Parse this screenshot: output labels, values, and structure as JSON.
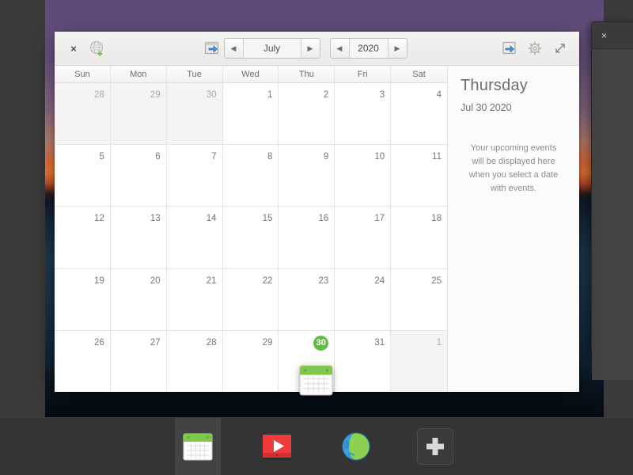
{
  "desktop": {
    "wallpaper_name": "sunset-lake-wallpaper",
    "background_window": {
      "close_label": "×"
    }
  },
  "calendar_window": {
    "toolbar": {
      "close_label": "×",
      "add_web_calendar_icon": "globe-plus-icon",
      "export_icon": "export-arrow-icon",
      "settings_icon": "gear-icon",
      "fullscreen_icon": "fullscreen-icon",
      "prev_month_label": "◀",
      "next_month_label": "▶",
      "month_value": "July",
      "prev_year_label": "◀",
      "next_year_label": "▶",
      "year_value": "2020"
    },
    "grid": {
      "day_headers": [
        "Sun",
        "Mon",
        "Tue",
        "Wed",
        "Thu",
        "Fri",
        "Sat"
      ],
      "weeks": [
        [
          {
            "num": "28",
            "out": true
          },
          {
            "num": "29",
            "out": true
          },
          {
            "num": "30",
            "out": true
          },
          {
            "num": "1",
            "out": false
          },
          {
            "num": "2",
            "out": false
          },
          {
            "num": "3",
            "out": false
          },
          {
            "num": "4",
            "out": false
          }
        ],
        [
          {
            "num": "5",
            "out": false
          },
          {
            "num": "6",
            "out": false
          },
          {
            "num": "7",
            "out": false
          },
          {
            "num": "8",
            "out": false
          },
          {
            "num": "9",
            "out": false
          },
          {
            "num": "10",
            "out": false
          },
          {
            "num": "11",
            "out": false
          }
        ],
        [
          {
            "num": "12",
            "out": false
          },
          {
            "num": "13",
            "out": false
          },
          {
            "num": "14",
            "out": false
          },
          {
            "num": "15",
            "out": false
          },
          {
            "num": "16",
            "out": false
          },
          {
            "num": "17",
            "out": false
          },
          {
            "num": "18",
            "out": false
          }
        ],
        [
          {
            "num": "19",
            "out": false
          },
          {
            "num": "20",
            "out": false
          },
          {
            "num": "21",
            "out": false
          },
          {
            "num": "22",
            "out": false
          },
          {
            "num": "23",
            "out": false
          },
          {
            "num": "24",
            "out": false
          },
          {
            "num": "25",
            "out": false
          }
        ],
        [
          {
            "num": "26",
            "out": false
          },
          {
            "num": "27",
            "out": false
          },
          {
            "num": "28",
            "out": false
          },
          {
            "num": "29",
            "out": false
          },
          {
            "num": "30",
            "out": false,
            "today": true
          },
          {
            "num": "31",
            "out": false
          },
          {
            "num": "1",
            "out": true
          }
        ]
      ]
    },
    "sidebar": {
      "weekday": "Thursday",
      "date": "Jul 30 2020",
      "message": "Your upcoming events will be displayed here when you select a date with events."
    }
  },
  "drag_icon": {
    "name": "calendar-app-icon"
  },
  "dock": {
    "items": [
      {
        "name": "calendar",
        "icon": "calendar-icon",
        "active": true
      },
      {
        "name": "video-player",
        "icon": "video-player-icon",
        "active": false
      },
      {
        "name": "web-browser",
        "icon": "globe-browser-icon",
        "active": false
      },
      {
        "name": "add-launcher",
        "icon": "plus-icon",
        "active": false
      }
    ]
  },
  "colors": {
    "today_green": "#64bb46",
    "dock_bg": "#343434",
    "window_bg": "#ffffff",
    "toolbar_bg": "#eeedec"
  }
}
